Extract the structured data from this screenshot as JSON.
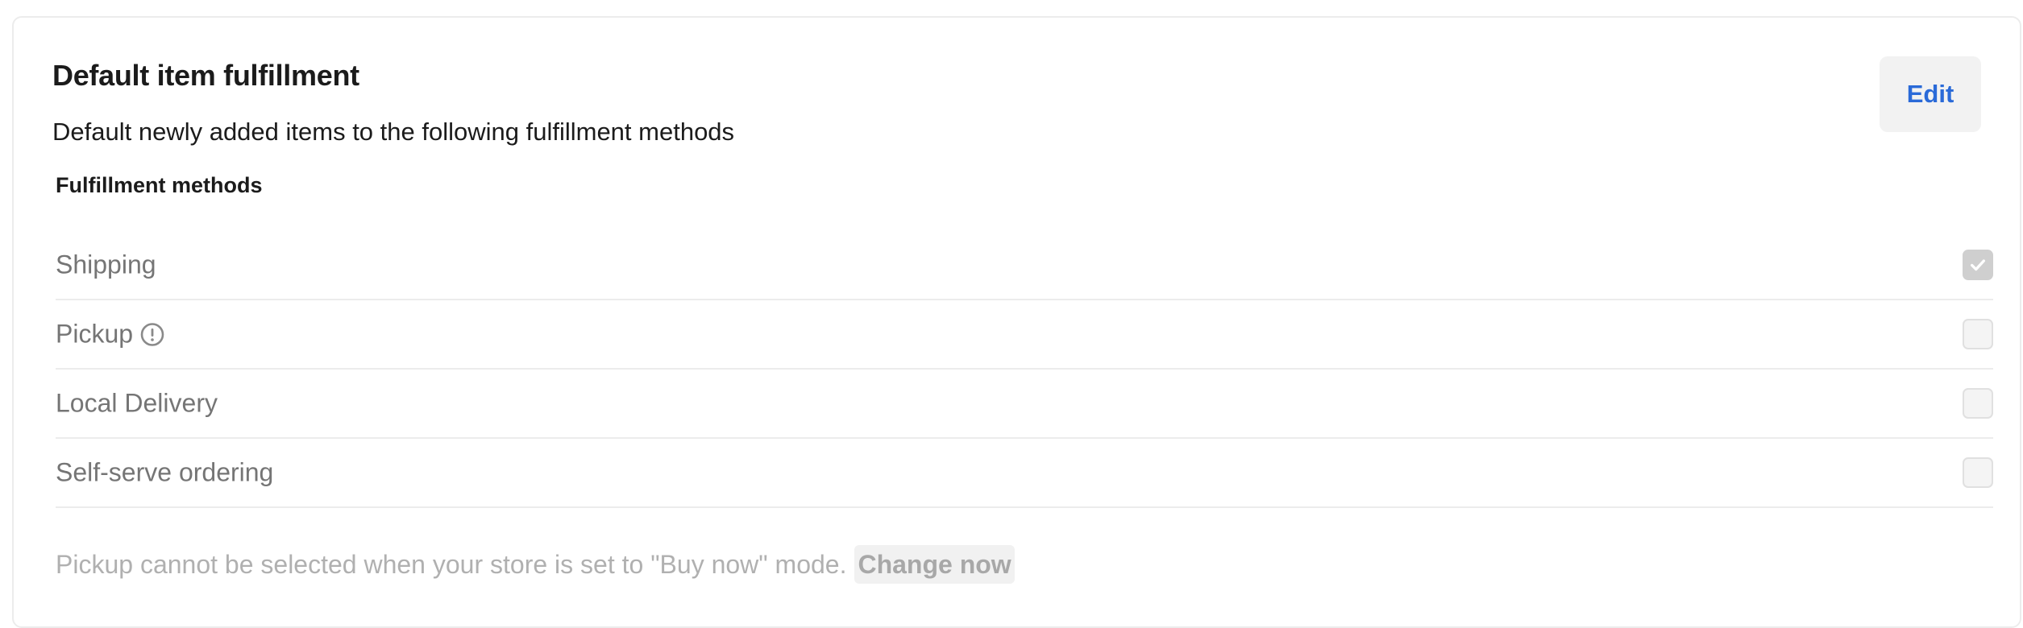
{
  "card": {
    "title": "Default item fulfillment",
    "subtitle": "Default newly added items to the following fulfillment methods",
    "edit_label": "Edit",
    "section_label": "Fulfillment methods"
  },
  "methods": [
    {
      "label": "Shipping",
      "checked": true
    },
    {
      "label": "Pickup",
      "checked": false,
      "has_info_icon": true
    },
    {
      "label": "Local Delivery",
      "checked": false
    },
    {
      "label": "Self-serve ordering",
      "checked": false
    }
  ],
  "footer": {
    "note": "Pickup cannot be selected when your store is set to \"Buy now\" mode.",
    "link_label": "Change now"
  },
  "colors": {
    "accent": "#2a6ad8",
    "text_primary": "#1b1b1b",
    "text_muted": "#757575",
    "text_disabled": "#b0b0b0"
  },
  "icons": {
    "info": "info-circle-icon",
    "check": "checkmark-icon"
  }
}
